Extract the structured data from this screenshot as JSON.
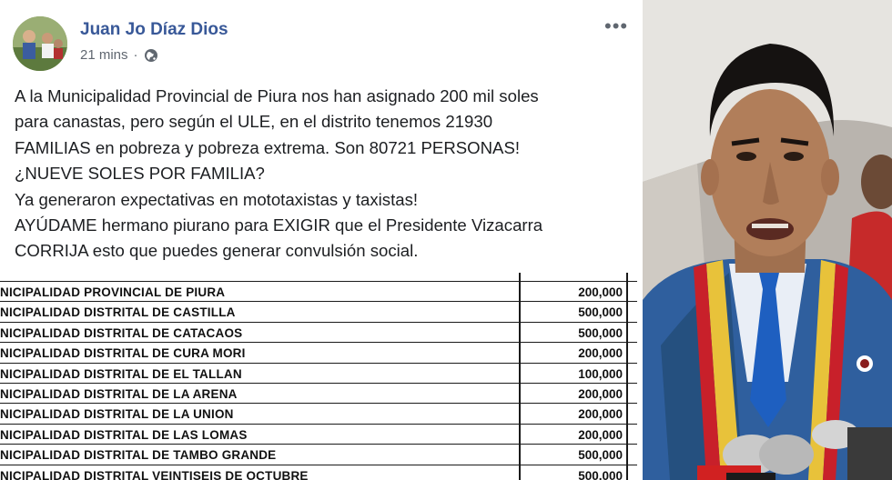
{
  "post": {
    "author": "Juan Jo Díaz Dios",
    "timestamp": "21 mins",
    "separator": "·",
    "more_icon": "more-options-icon",
    "privacy_icon": "globe-icon",
    "lines": [
      "A la Municipalidad Provincial de Piura nos han asignado 200 mil soles",
      "para canastas, pero según el ULE, en el distrito tenemos 21930",
      "FAMILIAS en pobreza y pobreza extrema. Son 80721 PERSONAS!",
      "¿NUEVE SOLES POR FAMILIA?",
      "Ya generaron expectativas en mototaxistas y taxistas!",
      "AYÚDAME hermano piurano para EXIGIR que el Presidente Vizacarra",
      "CORRIJA esto que puedes generar convulsión social."
    ]
  },
  "table": {
    "rows": [
      {
        "name": "NICIPALIDAD PROVINCIAL DE PIURA",
        "amount": "200,000"
      },
      {
        "name": "NICIPALIDAD DISTRITAL DE CASTILLA",
        "amount": "500,000"
      },
      {
        "name": "NICIPALIDAD DISTRITAL DE CATACAOS",
        "amount": "500,000"
      },
      {
        "name": "NICIPALIDAD DISTRITAL DE CURA MORI",
        "amount": "200,000"
      },
      {
        "name": "NICIPALIDAD DISTRITAL DE EL TALLAN",
        "amount": "100,000"
      },
      {
        "name": "NICIPALIDAD DISTRITAL DE LA ARENA",
        "amount": "200,000"
      },
      {
        "name": "NICIPALIDAD DISTRITAL DE LA UNION",
        "amount": "200,000"
      },
      {
        "name": "NICIPALIDAD DISTRITAL DE LAS LOMAS",
        "amount": "200,000"
      },
      {
        "name": "NICIPALIDAD DISTRITAL DE TAMBO GRANDE",
        "amount": "500,000"
      },
      {
        "name": "NICIPALIDAD DISTRITAL VEINTISEIS DE OCTUBRE",
        "amount": "500,000"
      }
    ]
  },
  "colors": {
    "author": "#385898",
    "meta": "#606770",
    "text": "#1c1e21",
    "suit": "#2f5f9e",
    "sash_red": "#c8202a",
    "sash_yellow": "#e8c23a"
  }
}
